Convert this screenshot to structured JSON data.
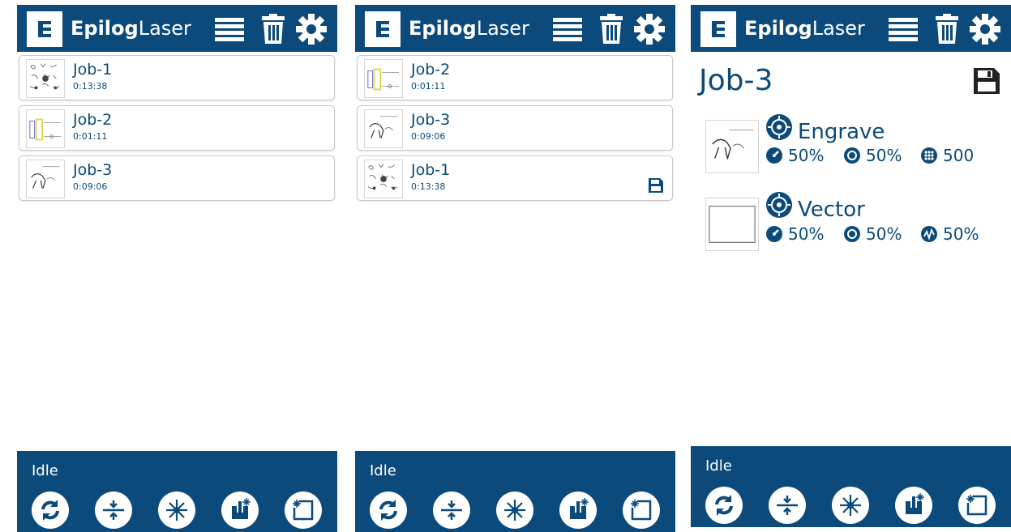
{
  "brand": {
    "name_bold": "Epilog",
    "name_light": "Laser"
  },
  "colors": {
    "primary": "#0b4a7a",
    "white": "#ffffff",
    "border": "#c8c8c8"
  },
  "header_icons": [
    "list-icon",
    "trash-icon",
    "gear-icon"
  ],
  "panels": [
    {
      "jobs": [
        {
          "name": "Job-1",
          "time": "0:13:38"
        },
        {
          "name": "Job-2",
          "time": "0:01:11"
        },
        {
          "name": "Job-3",
          "time": "0:09:06"
        }
      ]
    },
    {
      "jobs": [
        {
          "name": "Job-2",
          "time": "0:01:11"
        },
        {
          "name": "Job-3",
          "time": "0:09:06"
        },
        {
          "name": "Job-1",
          "time": "0:13:38",
          "saved_icon": "save-icon"
        }
      ]
    }
  ],
  "detail": {
    "title": "Job-3",
    "operations": [
      {
        "name": "Engrave",
        "params": [
          {
            "icon": "speed-icon",
            "value": "50%"
          },
          {
            "icon": "power-icon",
            "value": "50%"
          },
          {
            "icon": "dpi-icon",
            "value": "500"
          }
        ]
      },
      {
        "name": "Vector",
        "params": [
          {
            "icon": "speed-icon",
            "value": "50%"
          },
          {
            "icon": "power-icon",
            "value": "50%"
          },
          {
            "icon": "frequency-icon",
            "value": "50%"
          }
        ]
      }
    ]
  },
  "footer": {
    "status": "Idle",
    "buttons": [
      "refresh-icon",
      "focus-icon",
      "laser-icon",
      "jog-icon",
      "home-icon"
    ]
  }
}
